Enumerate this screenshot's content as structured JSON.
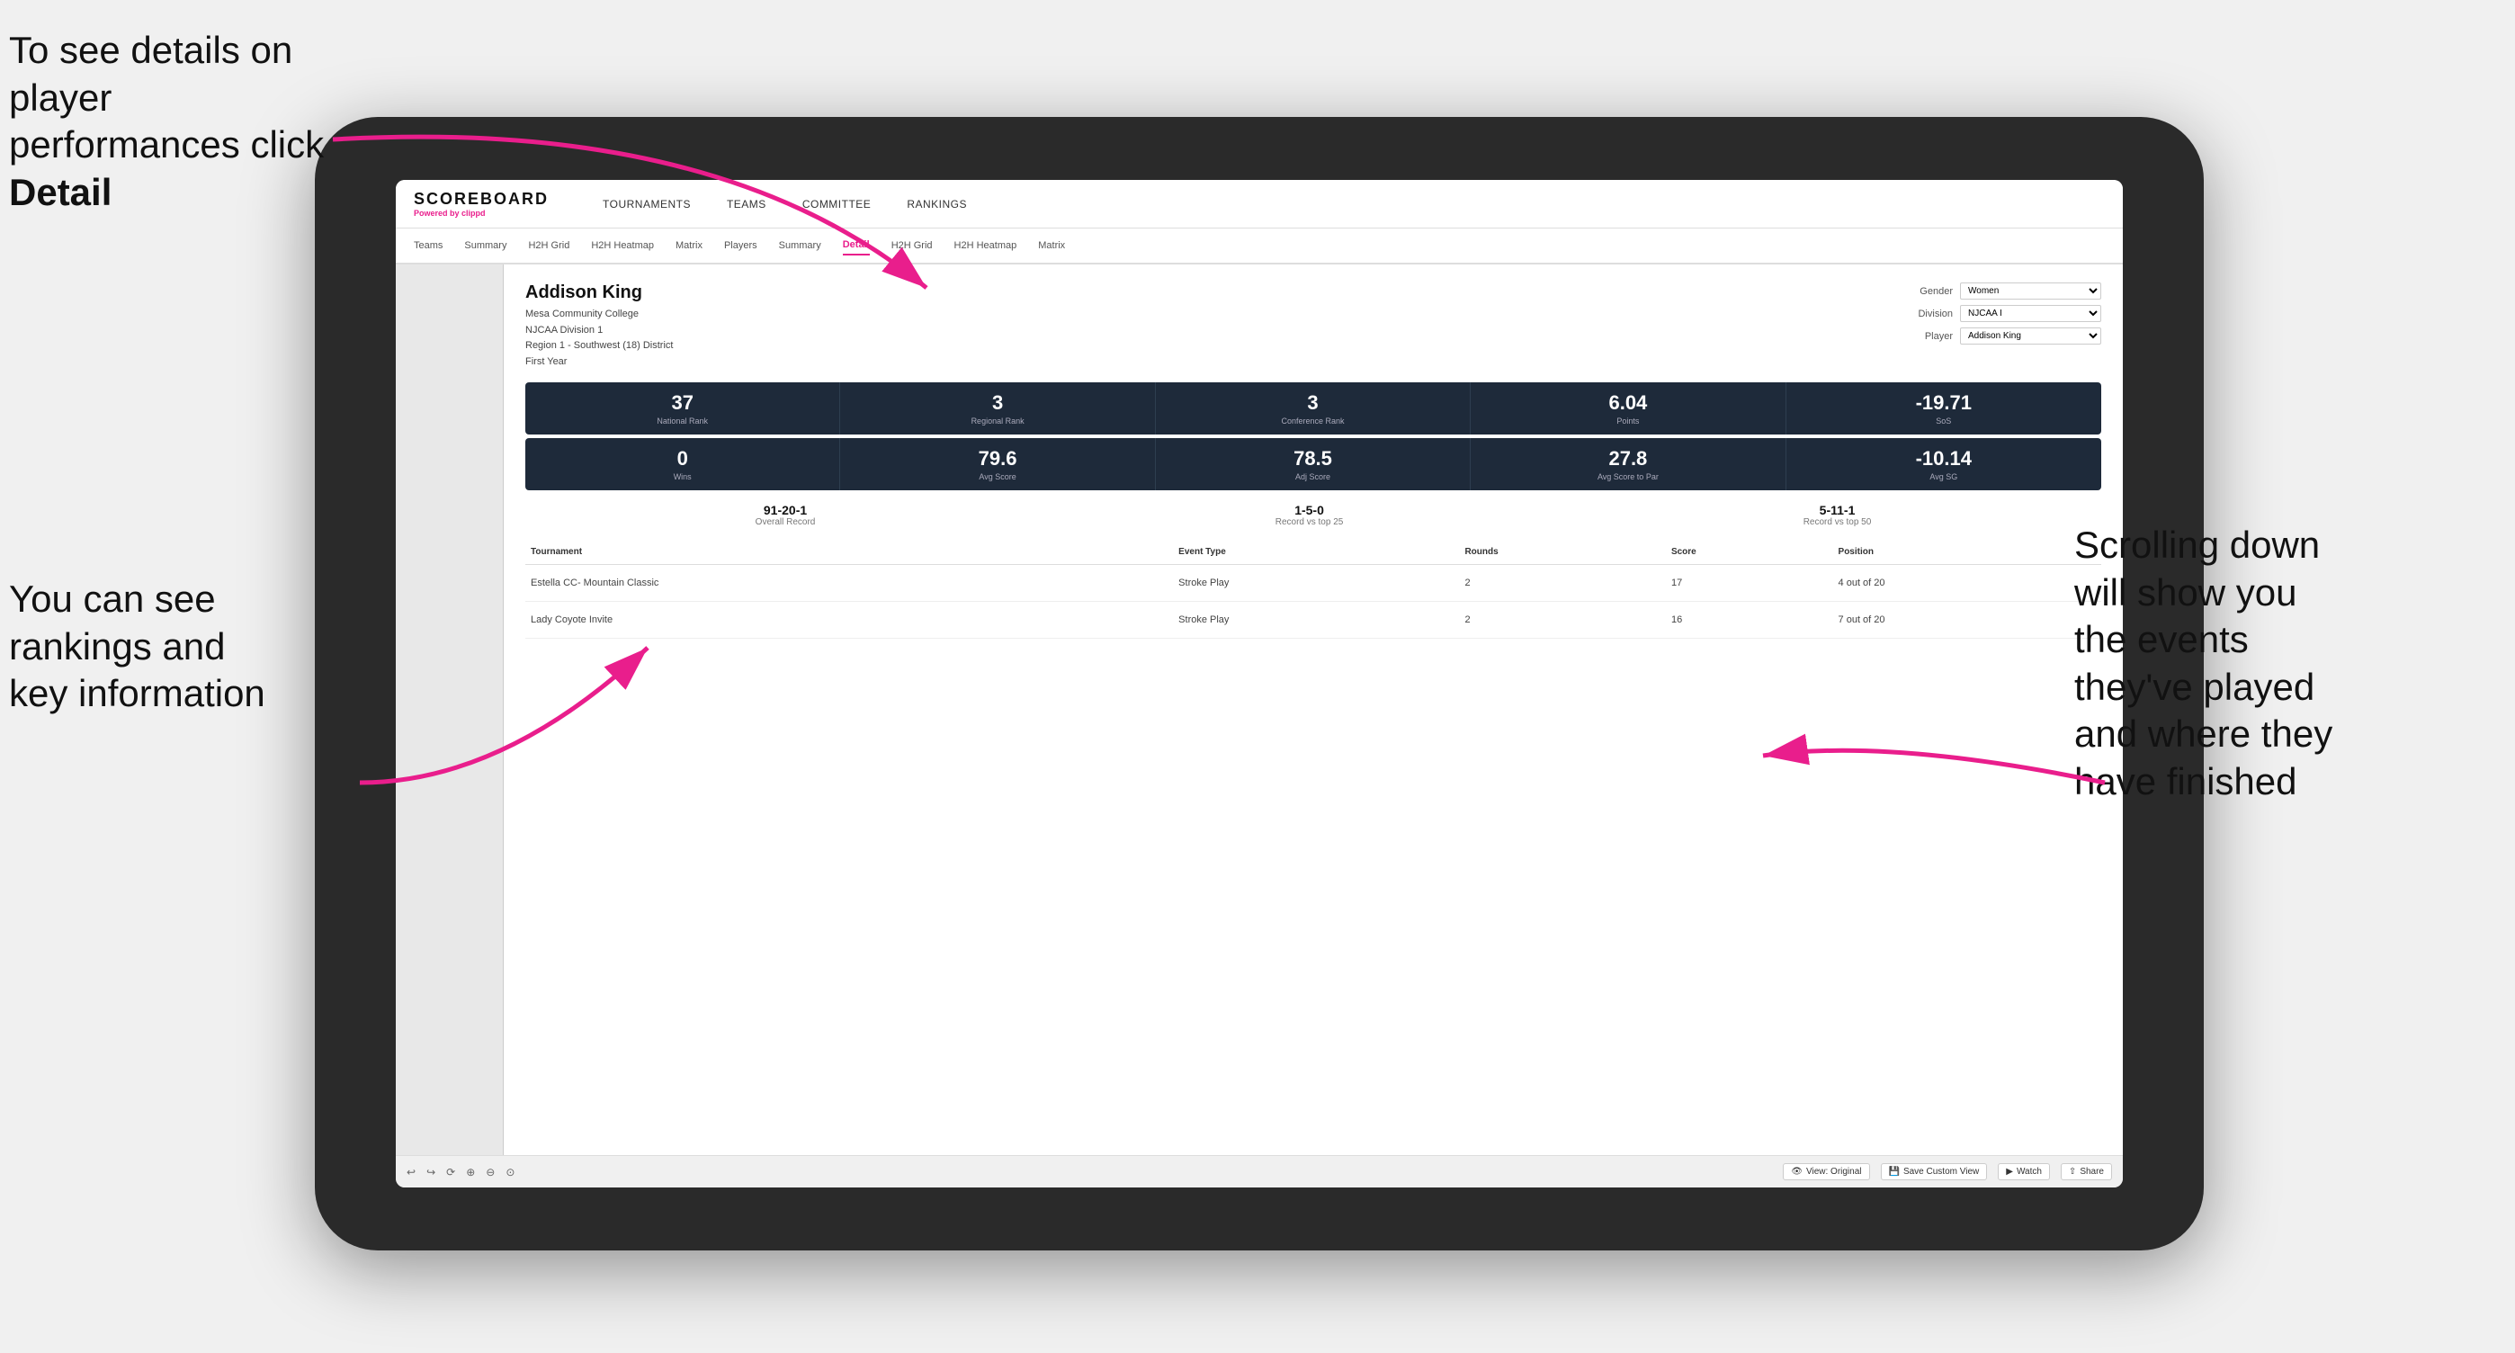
{
  "annotations": {
    "top_left": "To see details on player performances click ",
    "top_left_bold": "Detail",
    "bottom_left_line1": "You can see",
    "bottom_left_line2": "rankings and",
    "bottom_left_line3": "key information",
    "right_line1": "Scrolling down",
    "right_line2": "will show you",
    "right_line3": "the events",
    "right_line4": "they've played",
    "right_line5": "and where they",
    "right_line6": "have finished"
  },
  "nav": {
    "logo": "SCOREBOARD",
    "logo_sub": "Powered by ",
    "logo_brand": "clippd",
    "items": [
      "TOURNAMENTS",
      "TEAMS",
      "COMMITTEE",
      "RANKINGS"
    ]
  },
  "sub_nav": {
    "items": [
      "Teams",
      "Summary",
      "H2H Grid",
      "H2H Heatmap",
      "Matrix",
      "Players",
      "Summary",
      "Detail",
      "H2H Grid",
      "H2H Heatmap",
      "Matrix"
    ],
    "active": "Detail"
  },
  "player": {
    "name": "Addison King",
    "school": "Mesa Community College",
    "division": "NJCAA Division 1",
    "region": "Region 1 - Southwest (18) District",
    "year": "First Year"
  },
  "filters": {
    "gender_label": "Gender",
    "gender_value": "Women",
    "division_label": "Division",
    "division_value": "NJCAA I",
    "player_label": "Player",
    "player_value": "Addison King"
  },
  "stats_row1": [
    {
      "value": "37",
      "label": "National Rank"
    },
    {
      "value": "3",
      "label": "Regional Rank"
    },
    {
      "value": "3",
      "label": "Conference Rank"
    },
    {
      "value": "6.04",
      "label": "Points"
    },
    {
      "value": "-19.71",
      "label": "SoS"
    }
  ],
  "stats_row2": [
    {
      "value": "0",
      "label": "Wins"
    },
    {
      "value": "79.6",
      "label": "Avg Score"
    },
    {
      "value": "78.5",
      "label": "Adj Score"
    },
    {
      "value": "27.8",
      "label": "Avg Score to Par"
    },
    {
      "value": "-10.14",
      "label": "Avg SG"
    }
  ],
  "records": [
    {
      "value": "91-20-1",
      "label": "Overall Record"
    },
    {
      "value": "1-5-0",
      "label": "Record vs top 25"
    },
    {
      "value": "5-11-1",
      "label": "Record vs top 50"
    }
  ],
  "table": {
    "headers": [
      "Tournament",
      "Event Type",
      "Rounds",
      "Score",
      "Position"
    ],
    "rows": [
      {
        "tournament": "Estella CC- Mountain Classic",
        "event_type": "Stroke Play",
        "rounds": "2",
        "score": "17",
        "position": "4 out of 20"
      },
      {
        "tournament": "Lady Coyote Invite",
        "event_type": "Stroke Play",
        "rounds": "2",
        "score": "16",
        "position": "7 out of 20"
      }
    ]
  },
  "toolbar": {
    "view_label": "View: Original",
    "save_label": "Save Custom View",
    "watch_label": "Watch",
    "share_label": "Share"
  }
}
